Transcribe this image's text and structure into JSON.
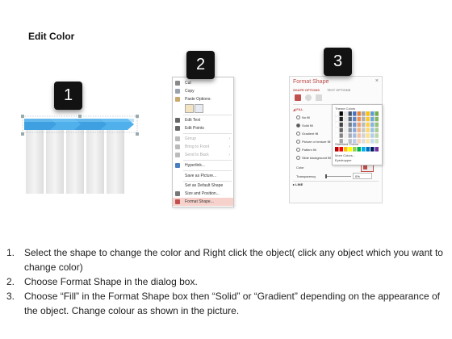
{
  "title": "Edit Color",
  "steps": [
    "1",
    "2",
    "3"
  ],
  "context_menu": {
    "items": [
      {
        "label": "Cut",
        "icon": "scissors-icon",
        "color": "#888888"
      },
      {
        "label": "Copy",
        "icon": "copy-icon",
        "color": "#9aa3ad"
      },
      {
        "label": "Paste Options:",
        "icon": "clipboard-icon",
        "color": "#c8a96b"
      },
      {
        "label": "Edit Text",
        "icon": "text-icon",
        "color": "#666666"
      },
      {
        "label": "Edit Points",
        "icon": "points-icon",
        "color": "#666666"
      },
      {
        "label": "Group",
        "icon": "group-icon",
        "color": "#bbbbbb"
      },
      {
        "label": "Bring to Front",
        "icon": "bring-front-icon",
        "color": "#bbbbbb"
      },
      {
        "label": "Send to Back",
        "icon": "send-back-icon",
        "color": "#bbbbbb"
      },
      {
        "label": "Hyperlink...",
        "icon": "hyperlink-icon",
        "color": "#4a7fbf"
      },
      {
        "label": "Save as Picture...",
        "icon": "",
        "color": ""
      },
      {
        "label": "Set as Default Shape",
        "icon": "",
        "color": ""
      },
      {
        "label": "Size and Position...",
        "icon": "size-icon",
        "color": "#777777"
      },
      {
        "label": "Format Shape...",
        "icon": "format-shape-icon",
        "color": "#c0504d"
      }
    ]
  },
  "format_shape": {
    "title": "Format Shape",
    "close": "×",
    "tabs": [
      "SHAPE OPTIONS",
      "TEXT OPTIONS"
    ],
    "fill_header": "FILL",
    "fill_options": [
      "No fill",
      "Solid fill",
      "Gradient fill",
      "Picture or texture fill",
      "Pattern fill",
      "Slide background fill"
    ],
    "color_label": "Color",
    "transparency_label": "Transparency",
    "transparency_value": "0%",
    "line_header": "LINE",
    "palette": {
      "theme_label": "Theme Colors",
      "standard_label": "Standard Colors",
      "more_colors": "More Colors...",
      "eyedropper": "Eyedropper"
    }
  },
  "instructions": [
    {
      "num": "1.",
      "text": "Select the shape to change the color and Right click the object( click any object which you want to change color)"
    },
    {
      "num": "2.",
      "text": "Choose Format Shape in the dialog box."
    },
    {
      "num": "3.",
      "text": "Choose “Fill” in the Format Shape box then “Solid” or “Gradient” depending on the appearance of the object. Change colour as shown in the picture."
    }
  ],
  "colors": {
    "arrow_blue": "#3ea0e0",
    "accent_red": "#c0504d",
    "badge": "#121212"
  }
}
